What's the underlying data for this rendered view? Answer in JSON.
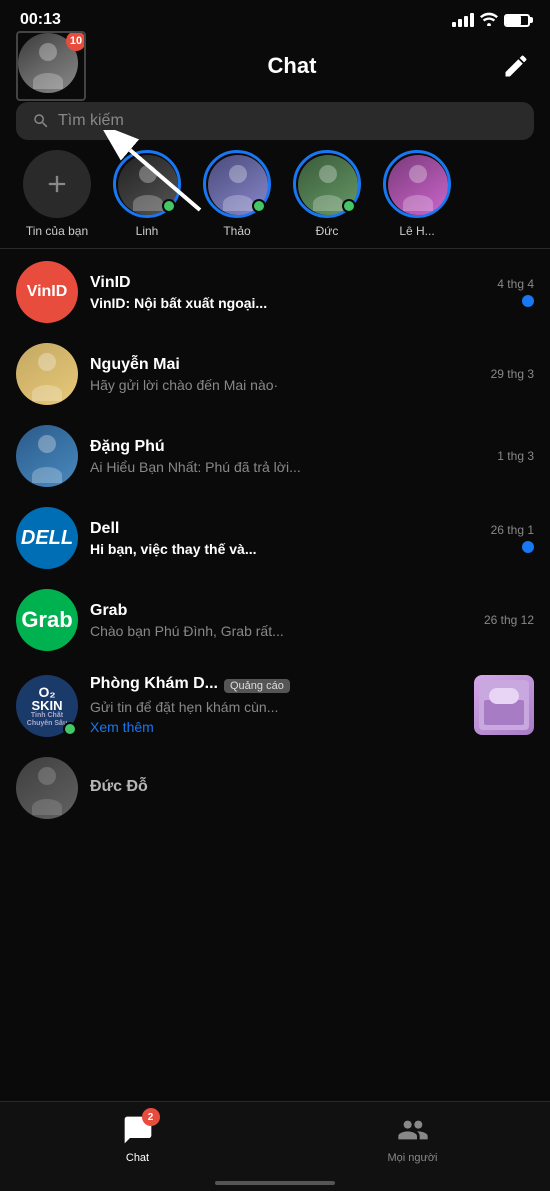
{
  "statusBar": {
    "time": "00:13",
    "battery": "70"
  },
  "header": {
    "title": "Chat",
    "badgeCount": "10",
    "composeLabel": "compose"
  },
  "search": {
    "placeholder": "Tìm kiếm"
  },
  "stories": [
    {
      "id": "add",
      "name": "Tin của bạn",
      "type": "add"
    },
    {
      "id": "linh",
      "name": "Linh",
      "type": "user",
      "online": true
    },
    {
      "id": "thao",
      "name": "Thảo",
      "type": "user",
      "online": true
    },
    {
      "id": "duc",
      "name": "Đức",
      "type": "user",
      "online": true
    },
    {
      "id": "leh",
      "name": "Lê H...",
      "type": "user",
      "online": false
    }
  ],
  "chats": [
    {
      "id": "vinid",
      "name": "VinID",
      "preview": "VinID: Nội bất xuất ngoại...",
      "time": "4 thg 4",
      "unread": true,
      "type": "vinid"
    },
    {
      "id": "nguyenmai",
      "name": "Nguyễn Mai",
      "preview": "Hãy gửi lời chào đến Mai nào·",
      "time": "29 thg 3",
      "unread": false,
      "type": "nguyen"
    },
    {
      "id": "dangphu",
      "name": "Đặng Phú",
      "preview": "Ai Hiểu Bạn Nhất: Phú đã trả lời...",
      "time": "1 thg 3",
      "unread": false,
      "type": "dang"
    },
    {
      "id": "dell",
      "name": "Dell",
      "preview": "Hi bạn, việc thay thế và...",
      "time": "26 thg 1",
      "unread": true,
      "type": "dell"
    },
    {
      "id": "grab",
      "name": "Grab",
      "preview": "Chào bạn Phú Đình, Grab rất...",
      "time": "26 thg 12",
      "unread": false,
      "type": "grab"
    },
    {
      "id": "phongkham",
      "name": "Phòng Khám D...",
      "preview": "Gửi tin để đặt hẹn khám cùn...",
      "time": "",
      "unread": false,
      "type": "phong",
      "isAd": true,
      "adLabel": "Quảng cáo",
      "seeMore": "Xem thêm"
    },
    {
      "id": "ducdo",
      "name": "Đức Đỗ",
      "preview": "...",
      "time": "",
      "unread": false,
      "type": "duc2"
    }
  ],
  "tabBar": {
    "tabs": [
      {
        "id": "chat",
        "label": "Chat",
        "active": true,
        "badge": "2"
      },
      {
        "id": "people",
        "label": "Mọi người",
        "active": false,
        "badge": ""
      }
    ]
  }
}
